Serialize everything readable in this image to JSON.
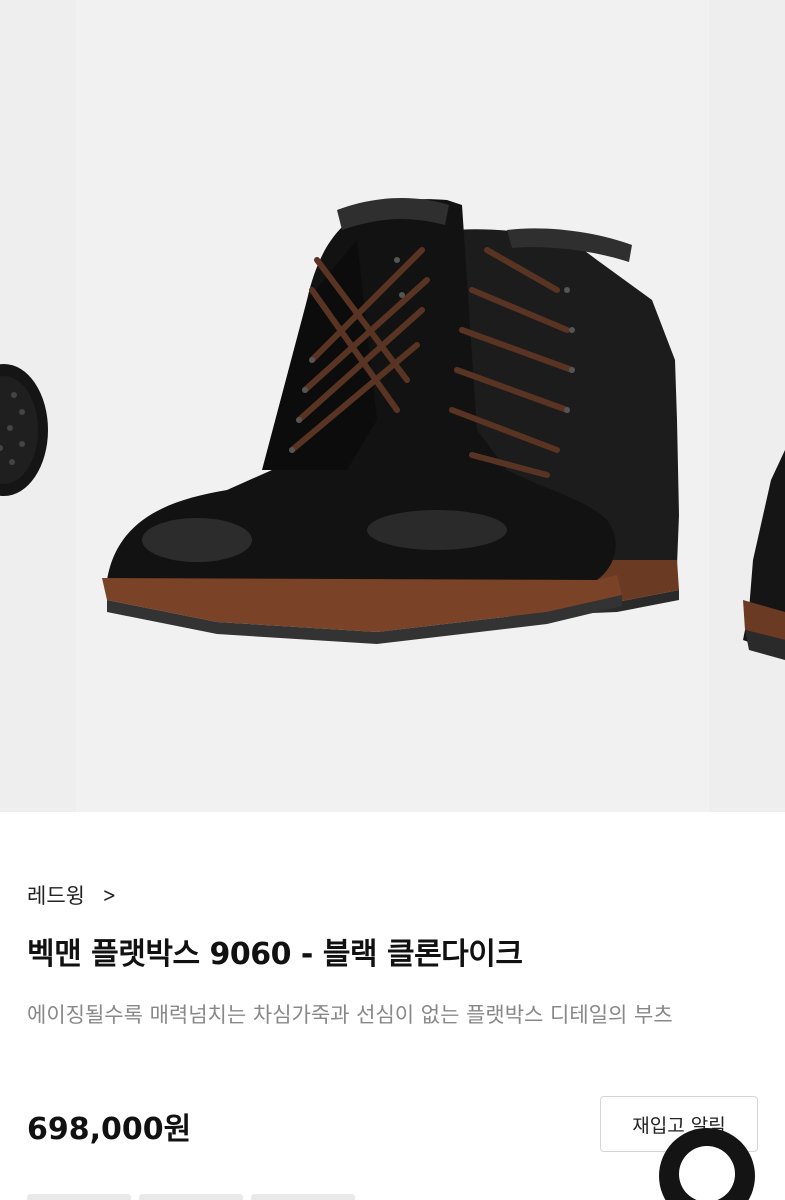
{
  "carousel": {
    "main_image": "black leather lace-up boots (pair)",
    "prev_image": "boot sole",
    "next_image": "boot"
  },
  "product": {
    "brand": "레드윙",
    "title": "벡맨 플랫박스 9060 - 블랙 클론다이크",
    "description": "에이징될수록 매력넘치는 차심가죽과 선심이 없는 플랫박스 디테일의 부츠",
    "price": "698,000원"
  },
  "actions": {
    "restock_alert": "재입고 알림"
  },
  "icons": {
    "brand_arrow": "chevron-right-icon",
    "floating": "chat-icon"
  },
  "colors": {
    "text_primary": "#111111",
    "text_muted": "#888888",
    "border": "#d5d5d5"
  }
}
